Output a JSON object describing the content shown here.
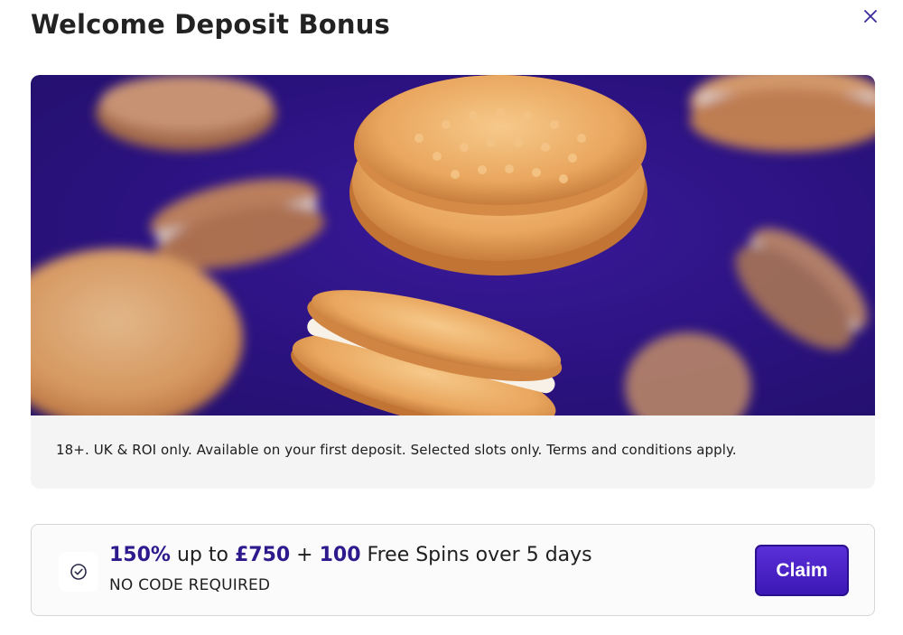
{
  "modal": {
    "title": "Welcome Deposit Bonus",
    "close_icon": "close-icon"
  },
  "promo": {
    "image_alt": "biscuits",
    "terms": "18+. UK & ROI only. Available on your first deposit. Selected slots only. Terms and conditions apply."
  },
  "offer": {
    "icon": "check-circle-icon",
    "percent": "150%",
    "up_to": " up to ",
    "amount": "£750",
    "plus": " + ",
    "spins_count": "100",
    "rest": " Free Spins over 5 days",
    "no_code": "NO CODE REQUIRED",
    "claim_label": "Claim"
  },
  "colors": {
    "accent": "#2e1a8c",
    "hero_bg": "#2b1280",
    "button": "#4a22c8"
  }
}
